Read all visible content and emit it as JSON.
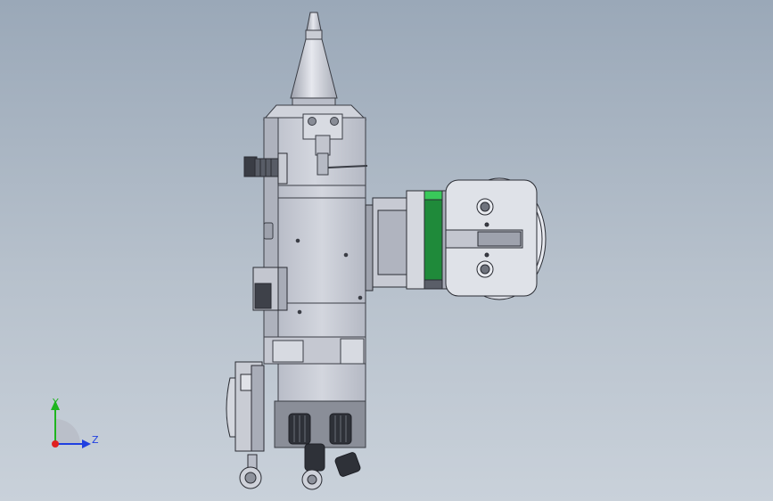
{
  "axes": {
    "y_label": "Y",
    "z_label": "Z",
    "y_color": "#1fb51f",
    "z_color": "#2040e0",
    "origin_color": "#e02020"
  },
  "colors": {
    "body": "#c9ccd4",
    "body_dark": "#a9adb8",
    "outline": "#3a3d45",
    "motor_green": "#1f8a3a",
    "motor_green_light": "#39c95a",
    "background_top": "#9aa8b8",
    "background_bottom": "#c9d1da"
  }
}
